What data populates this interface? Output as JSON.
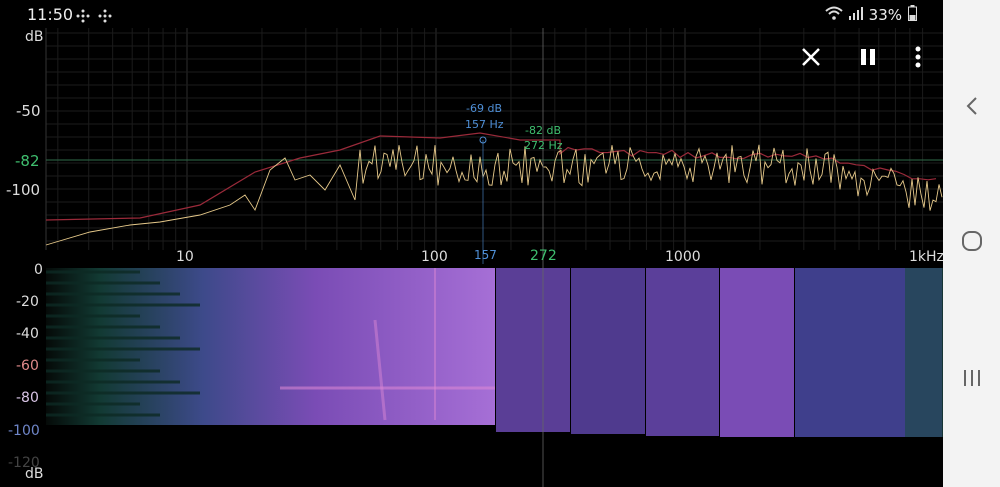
{
  "status_bar": {
    "time": "11:50",
    "battery_percent": "33%",
    "notification_icons": [
      "grid-dots-icon",
      "grid-dots-icon"
    ],
    "system_icons": [
      "wifi-icon",
      "signal-icon",
      "battery-icon"
    ]
  },
  "toolbar": {
    "close_icon": "close-icon",
    "pause_icon": "pause-icon",
    "more_icon": "more-vert-icon"
  },
  "spectrum": {
    "y_unit": "dB",
    "y_ticks": [
      "-50",
      "-100"
    ],
    "threshold_label": "-82",
    "x_ticks": [
      "10",
      "100",
      "1000",
      "1kHz"
    ],
    "peak_blue": {
      "db": "-69 dB",
      "hz": "157 Hz"
    },
    "peak_green": {
      "db": "-82 dB",
      "hz": "272 Hz"
    }
  },
  "markers": {
    "blue_label": "157",
    "green_label": "272"
  },
  "spectrogram": {
    "y_ticks": [
      "0",
      "-20",
      "-40",
      "-60",
      "-80",
      "-100",
      "-120"
    ],
    "y_unit": "dB"
  },
  "navbar": {
    "back_icon": "chevron-left-icon",
    "home_icon": "home-circle-icon",
    "recents_icon": "recents-icon"
  },
  "colors": {
    "blue_marker": "#4f8fd6",
    "green_marker": "#3fbf6f",
    "spectrum_red": "#9a2a3a",
    "spectrum_yellow": "#e6c98a",
    "spectrogram_purple": "#8a55c9"
  }
}
